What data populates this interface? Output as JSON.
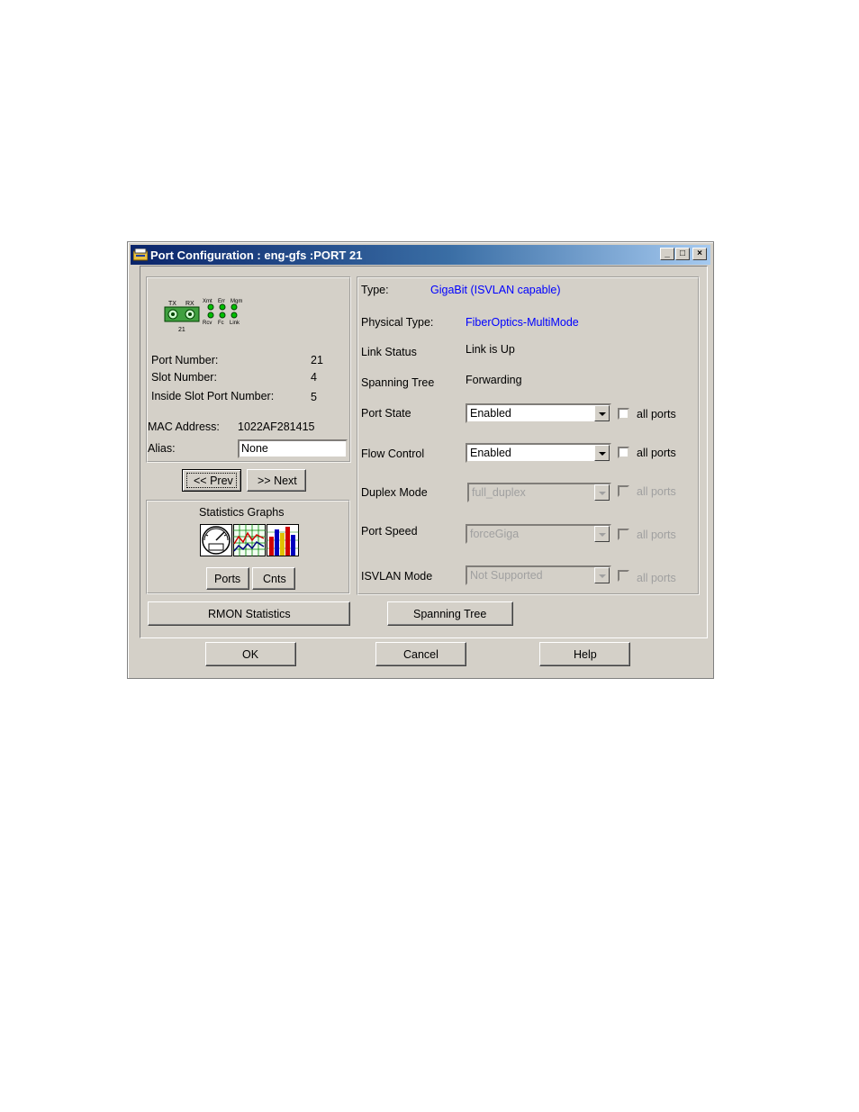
{
  "window": {
    "title": "Port Configuration : eng-gfs :PORT 21",
    "minimize": "_",
    "maximize": "□",
    "close": "×"
  },
  "port_icon": {
    "tx": "TX",
    "rx": "RX",
    "xmt": "Xmt",
    "err": "Err",
    "mgm": "Mgm",
    "rcv": "Rcv",
    "fc": "Fc",
    "link": "Link",
    "port_label": "21"
  },
  "info": {
    "port_number_label": "Port Number:",
    "port_number": "21",
    "slot_number_label": "Slot Number:",
    "slot_number": "4",
    "inside_slot_label": "Inside Slot Port Number:",
    "inside_slot": "5",
    "mac_label": "MAC Address:",
    "mac": "1022AF281415",
    "alias_label": "Alias:",
    "alias_value": "None"
  },
  "nav": {
    "prev": "<< Prev",
    "prev_mnemonic": "P",
    "next": ">> Next",
    "next_mnemonic": "N"
  },
  "stats": {
    "title": "Statistics Graphs",
    "ports": "Ports",
    "cnts": "Cnts"
  },
  "details": {
    "type_label": "Type:",
    "type_value": "GigaBit (ISVLAN capable)",
    "physical_label": "Physical Type:",
    "physical_value": "FiberOptics-MultiMode",
    "link_label": "Link Status",
    "link_value": "Link is Up",
    "spanning_label": "Spanning Tree",
    "spanning_value": "Forwarding",
    "port_state_label": "Port State",
    "port_state_value": "Enabled",
    "flow_label": "Flow Control",
    "flow_value": "Enabled",
    "duplex_label": "Duplex Mode",
    "duplex_value": "full_duplex",
    "speed_label": "Port Speed",
    "speed_value": "forceGiga",
    "isvlan_label": "ISVLAN Mode",
    "isvlan_value": "Not Supported",
    "all_ports": "all ports"
  },
  "buttons": {
    "rmon": "RMON Statistics",
    "spanning": "Spanning Tree",
    "ok": "OK",
    "cancel": "Cancel",
    "help": "Help"
  }
}
